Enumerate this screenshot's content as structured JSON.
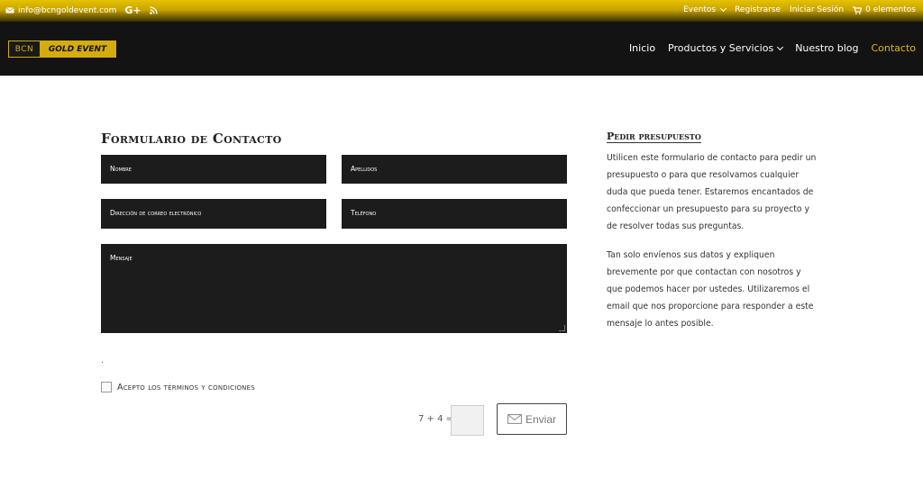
{
  "topbar": {
    "email": "info@bcngoldevent.com",
    "gplus": "G+",
    "links": [
      "Eventos",
      "Registrarse",
      "Iniciar Sesión"
    ],
    "cart": "0 elementos"
  },
  "logo": {
    "left": "BCN",
    "right": "GOLD EVENT"
  },
  "nav": [
    "Inicio",
    "Productos y Servicios",
    "Nuestro blog",
    "Contacto"
  ],
  "form": {
    "title": "Formulario de Contacto",
    "fields": {
      "name": "Nombre",
      "surname": "Apellidos",
      "email": "Dirección de correo electrónico",
      "phone": "Teléfono",
      "message": "Mensaje"
    },
    "dot": ".",
    "terms": "Acepto los términos y condiciones",
    "captcha": "7 + 4 =",
    "submit": "Enviar"
  },
  "sidebar": {
    "title": "Pedir presupuesto",
    "paragraph1": "Utilicen este formulario de contacto para pedir un presupuesto o para que resolvamos cualquier duda que pueda tener. Estaremos encantados de confeccionar un presupuesto para su proyecto y de resolver todas sus preguntas.",
    "paragraph2": "Tan solo envíenos sus datos y expliquen brevemente por que contactan con nosotros y que podemos hacer por ustedes. Utilizaremos el email que nos proporcione para responder a este mensaje  lo antes posible."
  },
  "colors": {
    "accent": "#e3b800",
    "header": "#131313",
    "field": "#1c1c1c"
  }
}
